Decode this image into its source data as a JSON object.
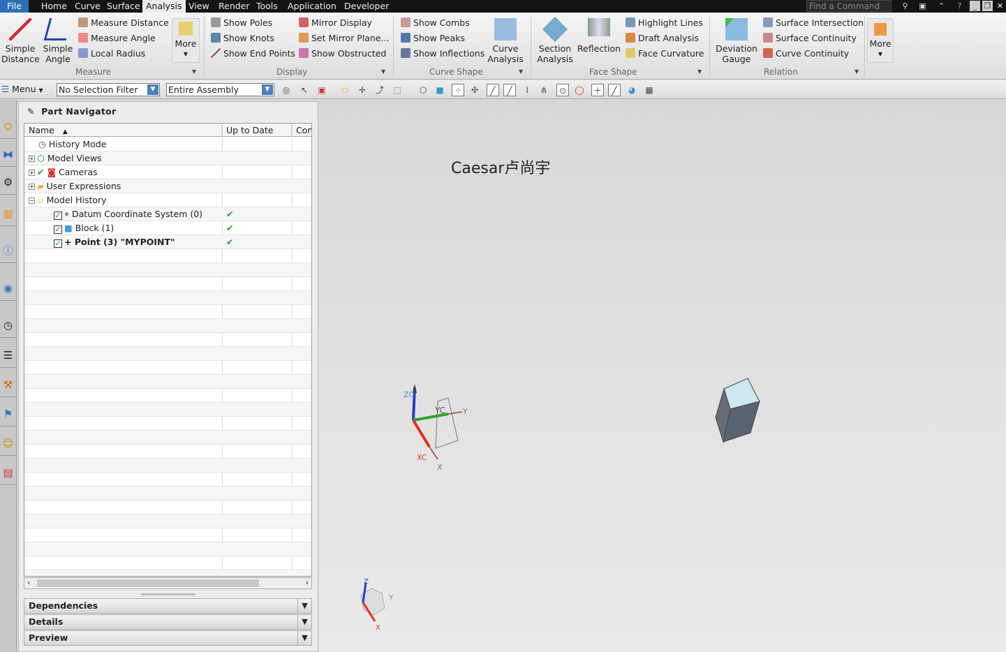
{
  "menubar": {
    "file": "File",
    "tabs": [
      "Home",
      "Curve",
      "Surface",
      "Analysis",
      "View",
      "Render",
      "Tools",
      "Application",
      "Developer"
    ],
    "active": "Analysis",
    "find_placeholder": "Find a Command"
  },
  "ribbon": {
    "measure": {
      "simple_distance": "Simple Distance",
      "simple_angle": "Simple Angle",
      "measure_distance": "Measure Distance",
      "measure_angle": "Measure Angle",
      "local_radius": "Local Radius",
      "more": "More",
      "group": "Measure"
    },
    "display": {
      "show_poles": "Show Poles",
      "show_knots": "Show Knots",
      "show_end_points": "Show End Points",
      "mirror_display": "Mirror Display",
      "set_mirror_plane": "Set Mirror Plane...",
      "show_obstructed": "Show Obstructed",
      "group": "Display"
    },
    "curve_shape": {
      "show_combs": "Show Combs",
      "show_peaks": "Show Peaks",
      "show_inflections": "Show Inflections",
      "curve_analysis": "Curve Analysis",
      "group": "Curve Shape"
    },
    "face_shape": {
      "section_analysis": "Section Analysis",
      "reflection": "Reflection",
      "highlight_lines": "Highlight Lines",
      "draft_analysis": "Draft Analysis",
      "face_curvature": "Face Curvature",
      "group": "Face Shape"
    },
    "relation": {
      "deviation_gauge": "Deviation Gauge",
      "surface_intersection": "Surface Intersection",
      "surface_continuity": "Surface Continuity",
      "curve_continuity": "Curve Continuity",
      "group": "Relation"
    },
    "more": "More"
  },
  "toolbar": {
    "menu": "Menu",
    "selection_filter": "No Selection Filter",
    "assembly_scope": "Entire Assembly"
  },
  "navigator": {
    "title": "Part Navigator",
    "columns": [
      "Name",
      "Up to Date",
      "Con"
    ],
    "rows": [
      {
        "name": "History Mode",
        "icon": "clock-icon",
        "up_to_date": false
      },
      {
        "name": "Model Views",
        "icon": "model-views-icon",
        "up_to_date": false,
        "expand": "+"
      },
      {
        "name": "Cameras",
        "icon": "camera-icon",
        "up_to_date": false,
        "expand": "+",
        "checked_mark": true
      },
      {
        "name": "User Expressions",
        "icon": "folder-icon",
        "up_to_date": false,
        "expand": "+"
      },
      {
        "name": "Model History",
        "icon": "folder-open-icon",
        "up_to_date": false,
        "expand": "-"
      },
      {
        "name": "Datum Coordinate System (0)",
        "icon": "datum-csys-icon",
        "up_to_date": true,
        "checkbox": true
      },
      {
        "name": "Block (1)",
        "icon": "block-icon",
        "up_to_date": true,
        "checkbox": true
      },
      {
        "name": "Point (3) \"MYPOINT\"",
        "icon": "point-icon",
        "up_to_date": true,
        "checkbox": true,
        "bold": true
      }
    ],
    "panels": [
      "Dependencies",
      "Details",
      "Preview"
    ]
  },
  "viewport": {
    "watermark": "Caesar卢尚宇",
    "wcs_labels": {
      "zc": "ZC",
      "yc": "YC",
      "xc": "XC",
      "x": "X",
      "y": "Y"
    },
    "triad_labels": {
      "z": "Z",
      "y": "Y",
      "x": "X"
    },
    "colors": {
      "x": "#e03020",
      "y": "#30a030",
      "z": "#2040d0",
      "cube_top": "#c8e6ee",
      "cube_side": "#5a6470"
    }
  }
}
